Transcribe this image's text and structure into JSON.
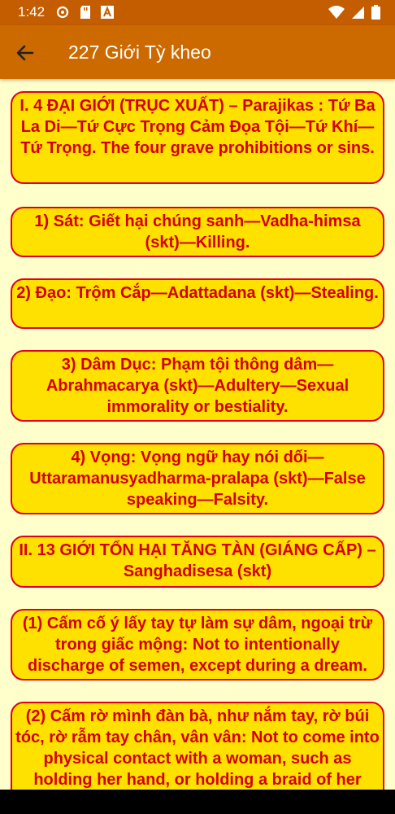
{
  "status": {
    "time": "1:42"
  },
  "appbar": {
    "title": "227 Giới Tỳ kheo",
    "back_icon": "arrow-left-icon"
  },
  "cards": [
    {
      "text": "I. 4 ĐẠI GIỚI (TRỤC XUẤT) – Parajikas : Tứ Ba La Di—Tứ Cực Trọng Cảm Đọa Tội—Tứ Khí—Tứ Trọng. The four grave prohibitions or sins."
    },
    {
      "text": "1) Sát: Giết hại chúng sanh—Vadha-himsa (skt)—Killing."
    },
    {
      "text": "2) Đạo: Trộm Cắp—Adattadana (skt)—Stealing."
    },
    {
      "text": "3) Dâm Dục: Phạm tội thông dâm—Abrahmacarya (skt)—Adultery—Sexual immorality or bestiality."
    },
    {
      "text": "4) Vọng: Vọng ngữ hay nói dối—Uttaramanusyadharma-pralapa (skt)—False speaking—Falsity."
    },
    {
      "text": "II. 13 GIỚI TỔN HẠI TĂNG TÀN (GIÁNG CẤP) – Sanghadisesa (skt)"
    },
    {
      "text": "(1) Cấm cố ý lấy tay tự làm sự dâm, ngoại trừ trong giấc mộng: Not to intentionally discharge of semen, except during a dream."
    },
    {
      "text": "(2) Cấm rờ mình đàn bà, như nắm tay, rờ búi tóc, rờ rẫm tay chân, vân vân: Not to come into physical contact with a woman, such as holding her hand, or holding a braid of her"
    }
  ]
}
